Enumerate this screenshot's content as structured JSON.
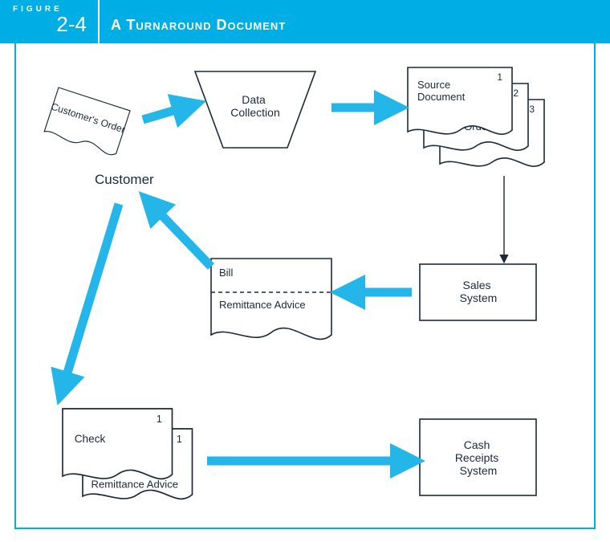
{
  "header": {
    "figure_label": "FIGURE",
    "figure_number": "2-4",
    "title": "A Turnaround Document"
  },
  "nodes": {
    "customers_order": "Customer's Order",
    "data_collection": "Data\nCollection",
    "customer": "Customer",
    "source_document": "Source\nDocument",
    "sales_order": "Sales Order",
    "sales_system": "Sales\nSystem",
    "bill": "Bill",
    "remittance_advice": "Remittance Advice",
    "check": "Check",
    "cash_receipts_system": "Cash\nReceipts\nSystem",
    "copy_1": "1",
    "copy_2": "2",
    "copy_3": "3"
  },
  "chart_data": {
    "type": "diagram",
    "title": "A Turnaround Document",
    "nodes": [
      {
        "id": "customer",
        "label": "Customer",
        "shape": "text"
      },
      {
        "id": "customers_order",
        "label": "Customer's Order",
        "shape": "document"
      },
      {
        "id": "data_collection",
        "label": "Data Collection",
        "shape": "manual-input-trapezoid"
      },
      {
        "id": "source_document",
        "label": "Source Document",
        "shape": "document",
        "copy": 1
      },
      {
        "id": "sales_order",
        "label": "Sales Order",
        "shape": "document",
        "copy": 2
      },
      {
        "id": "sales_order_copy3",
        "label": "",
        "shape": "document",
        "copy": 3
      },
      {
        "id": "sales_system",
        "label": "Sales System",
        "shape": "process-rectangle"
      },
      {
        "id": "bill_remittance",
        "label": "Bill / Remittance Advice",
        "shape": "tear-off-document"
      },
      {
        "id": "check",
        "label": "Check",
        "shape": "document",
        "copy": 1
      },
      {
        "id": "remittance_advice_out",
        "label": "Remittance Advice",
        "shape": "document",
        "copy": 1
      },
      {
        "id": "cash_receipts_system",
        "label": "Cash Receipts System",
        "shape": "process-rectangle"
      }
    ],
    "edges": [
      {
        "from": "customers_order",
        "to": "data_collection",
        "style": "thick-blue"
      },
      {
        "from": "data_collection",
        "to": "source_document",
        "style": "thick-blue"
      },
      {
        "from": "sales_order_copy3",
        "to": "sales_system",
        "style": "thin-black"
      },
      {
        "from": "sales_system",
        "to": "bill_remittance",
        "style": "thick-blue"
      },
      {
        "from": "bill_remittance",
        "to": "customer",
        "style": "thick-blue"
      },
      {
        "from": "customer",
        "to": "check",
        "style": "thick-blue"
      },
      {
        "from": "remittance_advice_out",
        "to": "cash_receipts_system",
        "style": "thick-blue"
      }
    ]
  }
}
